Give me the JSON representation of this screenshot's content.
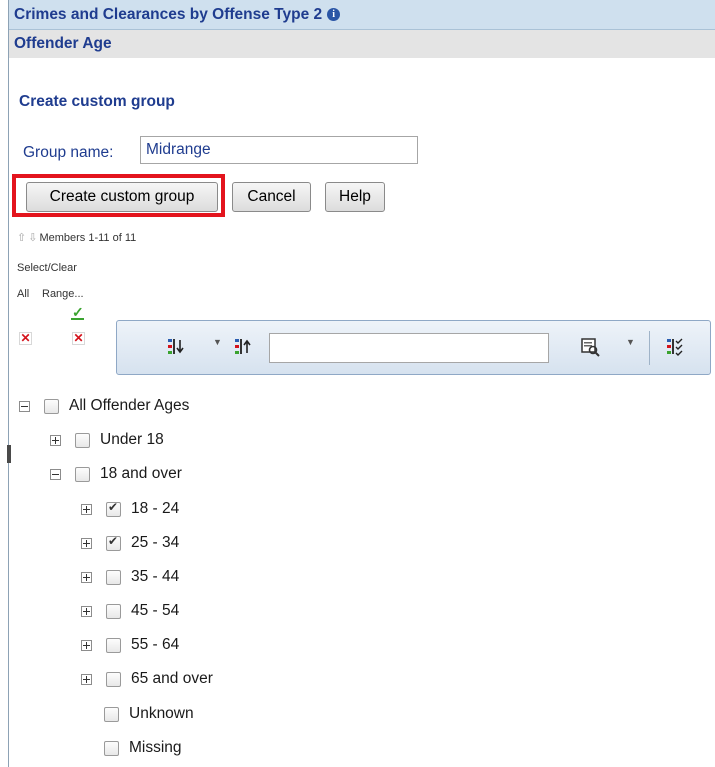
{
  "header": {
    "title": "Crimes and Clearances by Offense Type 2",
    "subtitle": "Offender Age"
  },
  "form": {
    "section_title": "Create custom group",
    "group_name_label": "Group name:",
    "group_name_value": "Midrange"
  },
  "buttons": {
    "create_label": "Create custom group",
    "cancel_label": "Cancel",
    "help_label": "Help"
  },
  "members": {
    "text": "Members 1-11 of 11",
    "select_clear": "Select/Clear",
    "all_label": "All",
    "range_label": "Range..."
  },
  "toolbar": {
    "search_value": "",
    "icons": [
      "sort-descending-icon",
      "sort-ascending-icon",
      "search-options-icon",
      "show-selected-icon"
    ]
  },
  "tree": {
    "items": [
      {
        "label": "All Offender Ages",
        "checked": false,
        "expander": "minus"
      },
      {
        "label": "Under 18",
        "checked": false,
        "expander": "plus"
      },
      {
        "label": "18 and over",
        "checked": false,
        "expander": "minus"
      },
      {
        "label": "18 - 24",
        "checked": true,
        "expander": "plus"
      },
      {
        "label": "25 - 34",
        "checked": true,
        "expander": "plus"
      },
      {
        "label": "35 - 44",
        "checked": false,
        "expander": "plus"
      },
      {
        "label": "45 - 54",
        "checked": false,
        "expander": "plus"
      },
      {
        "label": "55 - 64",
        "checked": false,
        "expander": "plus"
      },
      {
        "label": "65 and over",
        "checked": false,
        "expander": "plus"
      },
      {
        "label": "Unknown",
        "checked": false,
        "expander": "none"
      },
      {
        "label": "Missing",
        "checked": false,
        "expander": "none"
      }
    ]
  },
  "colors": {
    "title_blue": "#1f3c8f",
    "highlight_red": "#e3141d",
    "header_bg": "#cfe0ee"
  }
}
